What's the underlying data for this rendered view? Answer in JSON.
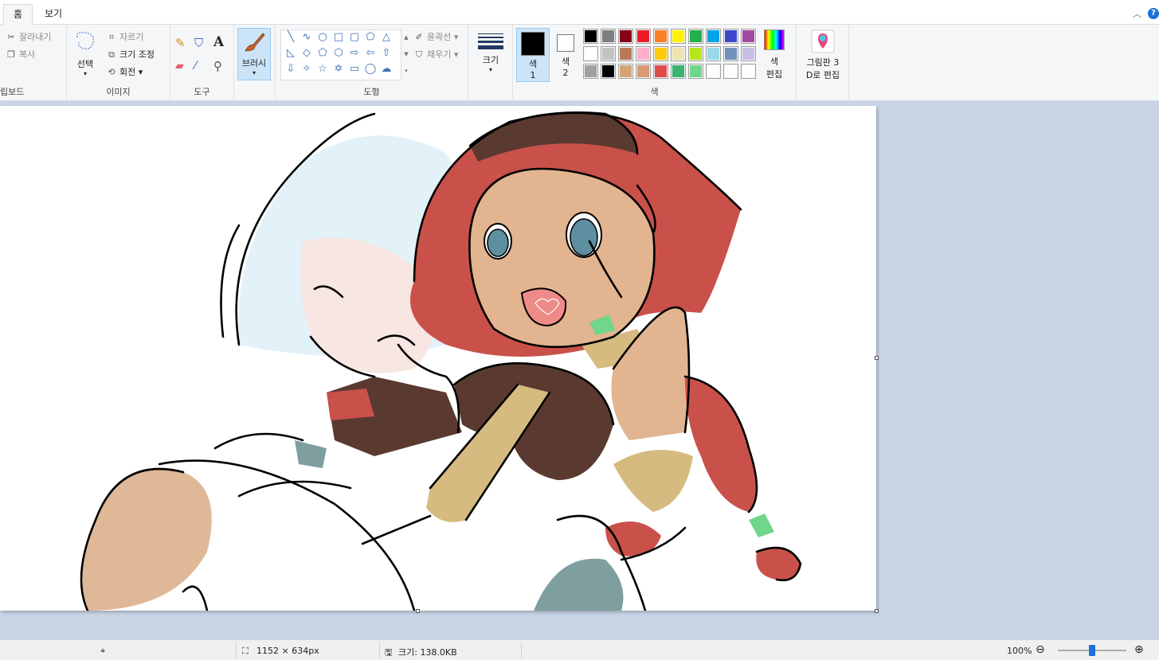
{
  "tabs": [
    {
      "label": "홈",
      "active": true
    },
    {
      "label": "보기",
      "active": false
    }
  ],
  "clipboard": {
    "cut_label": "잘라내기",
    "copy_label": "복사",
    "group_label": "립보드"
  },
  "image_group": {
    "select_label": "선택",
    "crop_label": "자르기",
    "resize_label": "크기 조정",
    "rotate_label": "회전",
    "group_label": "이미지"
  },
  "tools_group": {
    "group_label": "도구",
    "icons": [
      "pencil-icon",
      "fill-icon",
      "text-icon",
      "eraser-icon",
      "color-picker-icon",
      "magnifier-icon"
    ]
  },
  "brush": {
    "label": "브러시"
  },
  "shapes_group": {
    "group_label": "도형",
    "outline_label": "윤곽선",
    "fill_label": "채우기",
    "shapes": [
      "╲",
      "∿",
      "○",
      "□",
      "▢",
      "⬠",
      "△",
      "◺",
      "◇",
      "⬠",
      "⬡",
      "⇨",
      "⇦",
      "⇧",
      "⇩",
      "✧",
      "☆",
      "✡",
      "▭",
      "◯",
      "☁"
    ]
  },
  "size": {
    "label": "크기"
  },
  "color1": {
    "label": "색",
    "number": "1",
    "value": "#000000"
  },
  "color2": {
    "label": "색",
    "number": "2",
    "value": "#ffffff"
  },
  "colors_group": {
    "group_label": "색",
    "row1": [
      "#000000",
      "#7f7f7f",
      "#880015",
      "#ed1c24",
      "#ff7f27",
      "#fff200",
      "#22b14c",
      "#00a2e8",
      "#3f48cc",
      "#a349a4"
    ],
    "row2": [
      "#ffffff",
      "#c3c3c3",
      "#b97a57",
      "#ffaec9",
      "#ffc90e",
      "#efe4b0",
      "#b5e61d",
      "#99d9ea",
      "#7092be",
      "#c8bfe7"
    ],
    "row3": [
      "#a0a0a0",
      "#000000",
      "#d4a373",
      "#d89a72",
      "#e04c4c",
      "#3cb371",
      "#6fd68a",
      "#ffffff",
      "#ffffff",
      "#ffffff"
    ]
  },
  "edit_colors": {
    "label_line1": "색",
    "label_line2": "편집"
  },
  "paint3d": {
    "label_line1": "그림판 3",
    "label_line2": "D로 편집"
  },
  "status": {
    "dimensions": "1152 × 634px",
    "size": "크기: 138.0KB",
    "zoom": "100%",
    "zoom_level": 0.5
  }
}
